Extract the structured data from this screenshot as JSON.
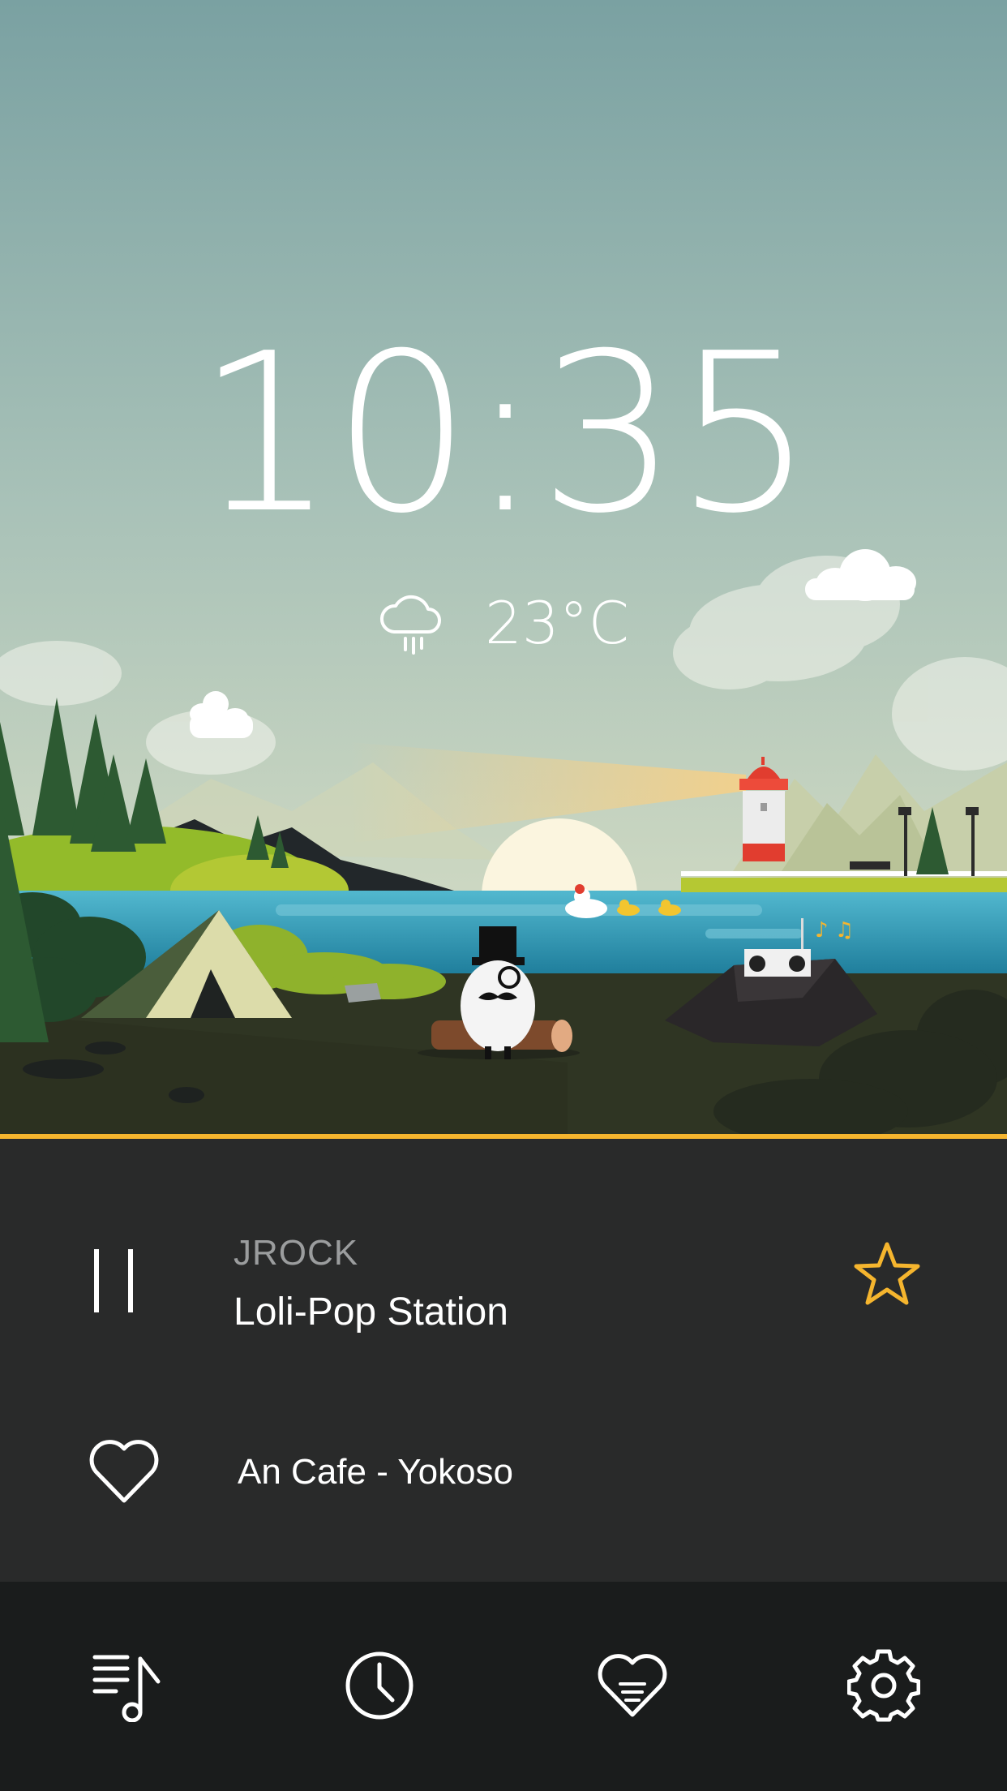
{
  "clock": {
    "time": "10:35"
  },
  "weather": {
    "temperature": "23°C",
    "icon": "rain-cloud-icon"
  },
  "player": {
    "genre": "JROCK",
    "station": "Loli-Pop Station",
    "song": "An Cafe - Yokoso",
    "state": "playing"
  },
  "nav": {
    "items": [
      {
        "icon": "music-list-icon"
      },
      {
        "icon": "clock-icon"
      },
      {
        "icon": "heart-list-icon"
      },
      {
        "icon": "gear-icon"
      }
    ]
  },
  "colors": {
    "accent": "#f5b52e",
    "player_bg": "#292a2a",
    "nav_bg": "#1a1c1c",
    "sky_top": "#7aa1a2",
    "lake": "#3aa5c2",
    "ground": "#2f3523"
  }
}
